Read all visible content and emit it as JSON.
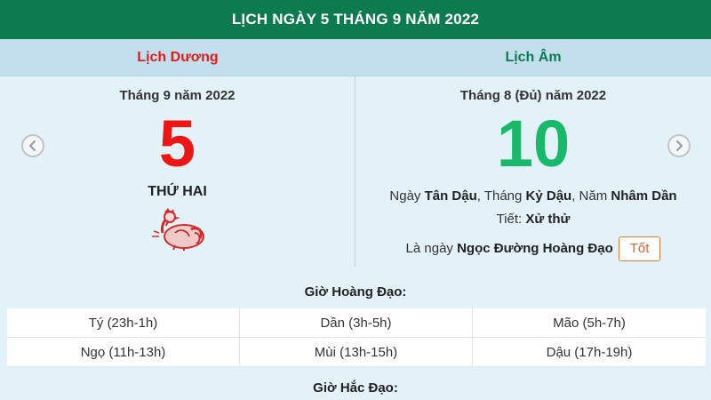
{
  "header": {
    "title": "LỊCH NGÀY 5 THÁNG 9 NĂM 2022"
  },
  "columns": {
    "solar_title": "Lịch Dương",
    "lunar_title": "Lịch Âm"
  },
  "solar": {
    "month_year": "Tháng 9 năm 2022",
    "day": "5",
    "weekday": "THỨ HAI",
    "zodiac_icon": "rooster-icon"
  },
  "lunar": {
    "month_year": "Tháng 8 (Đủ) năm 2022",
    "day": "10",
    "ngay_prefix": "Ngày ",
    "ngay_value": "Tân Dậu",
    "thang_prefix": ", Tháng ",
    "thang_value": "Kỷ Dậu",
    "nam_prefix": ", Năm ",
    "nam_value": "Nhâm Dần",
    "tiet_prefix": "Tiết: ",
    "tiet_value": "Xử thử",
    "la_ngay_prefix": "Là ngày ",
    "la_ngay_value": "Ngọc Đường Hoàng Đạo",
    "badge": "Tốt"
  },
  "nav": {
    "prev_icon": "chevron-left-icon",
    "next_icon": "chevron-right-icon"
  },
  "gio_hoang_dao": {
    "title": "Giờ Hoàng Đạo:",
    "cells": [
      "Tý (23h-1h)",
      "Dần (3h-5h)",
      "Mão (5h-7h)",
      "Ngọ (11h-13h)",
      "Mùi (13h-15h)",
      "Dậu (17h-19h)"
    ]
  },
  "gio_hac_dao": {
    "title": "Giờ Hắc Đạo:"
  },
  "colors": {
    "header_bg": "#0e7a4f",
    "solar_accent": "#ee1515",
    "lunar_accent": "#18b96a",
    "badge_border": "#e07a3c",
    "panel_bg": "#e3f1f9"
  }
}
